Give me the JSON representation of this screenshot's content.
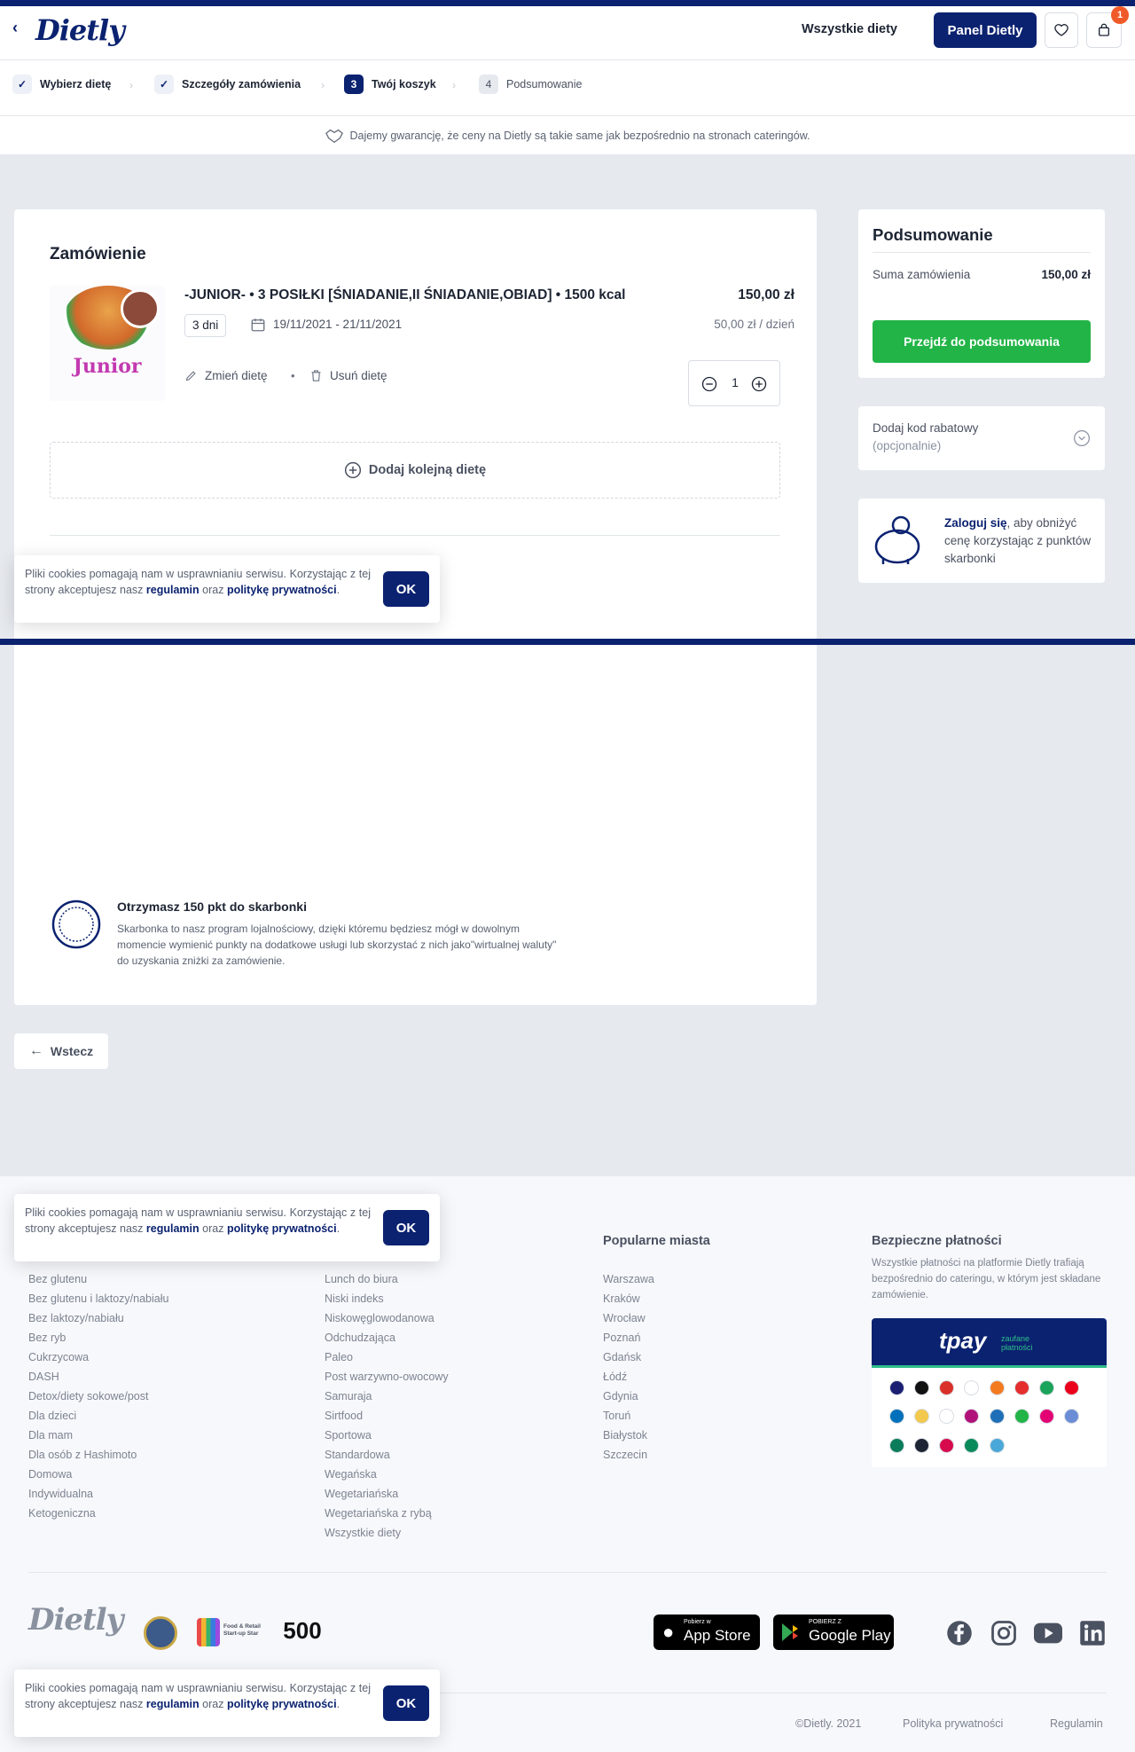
{
  "header": {
    "logo": "Dietly",
    "all_diets": "Wszystkie diety",
    "panel_button": "Panel Dietly",
    "cart_count": "1"
  },
  "steps": [
    {
      "label": "Wybierz dietę",
      "num": ""
    },
    {
      "label": "Szczegóły zamówienia",
      "num": ""
    },
    {
      "label": "Twój koszyk",
      "num": "3"
    },
    {
      "label": "Podsumowanie",
      "num": "4"
    }
  ],
  "guarantee": "Dajemy gwarancję, że ceny na Dietly są takie same jak bezpośrednio na stronach cateringów.",
  "order": {
    "title": "Zamówienie",
    "image_text": "Junior",
    "name": "-JUNIOR- • 3 POSIŁKI [ŚNIADANIE,II ŚNIADANIE,OBIAD] • 1500 kcal",
    "price": "150,00 zł",
    "days": "3 dni",
    "dates": "19/11/2021 - 21/11/2021",
    "per_day": "50,00 zł / dzień",
    "change": "Zmień dietę",
    "remove": "Usuń dietę",
    "quantity": "1",
    "add_another": "Dodaj kolejną dietę",
    "points_title": "Otrzymasz 150 pkt do skarbonki",
    "points_desc": "Skarbonka to nasz program lojalnościowy, dzięki któremu będziesz mógł w dowolnym momencie wymienić punkty na dodatkowe usługi lub skorzystać z nich jako\"wirtualnej waluty\" do uzyskania zniżki za zamówienie."
  },
  "back_button": "Wstecz",
  "summary": {
    "title": "Podsumowanie",
    "sum_label": "Suma zamówienia",
    "sum_value": "150,00 zł",
    "go_button": "Przejdź do podsumowania",
    "discount_label": "Dodaj kod rabatowy",
    "discount_optional": "(opcjonalnie)",
    "login_link": "Zaloguj się",
    "login_rest": ", aby obniżyć cenę korzystając z punktów skarbonki"
  },
  "cookie": {
    "text": "Pliki cookies pomagają nam w usprawnianiu serwisu. Korzystając z tej strony akceptujesz nasz",
    "regulamin": "regulamin",
    "oraz": "oraz",
    "privacy": "politykę prywatności",
    "ok": "OK"
  },
  "footer": {
    "col1": [
      "Bez glutenu",
      "Bez glutenu i laktozy/nabiału",
      "Bez laktozy/nabiału",
      "Bez ryb",
      "Cukrzycowa",
      "DASH",
      "Detox/diety sokowe/post",
      "Dla dzieci",
      "Dla mam",
      "Dla osób z Hashimoto",
      "Domowa",
      "Indywidualna",
      "Ketogeniczna"
    ],
    "col2": [
      "Lunch do biura",
      "Niski indeks",
      "Niskowęglowodanowa",
      "Odchudzająca",
      "Paleo",
      "Post warzywno-owocowy",
      "Samuraja",
      "Sirtfood",
      "Sportowa",
      "Standardowa",
      "Wegańska",
      "Wegetariańska",
      "Wegetariańska z rybą",
      "Wszystkie diety"
    ],
    "cities_title": "Popularne miasta",
    "cities": [
      "Warszawa",
      "Kraków",
      "Wrocław",
      "Poznań",
      "Gdańsk",
      "Łódź",
      "Gdynia",
      "Toruń",
      "Białystok",
      "Szczecin"
    ],
    "payments_title": "Bezpieczne płatności",
    "payments_desc": "Wszystkie płatności na platformie Dietly trafiają bezpośrednio do cateringu, w którym jest składane zamówienie.",
    "tpay": "tpay",
    "tpay_sub": "zaufane płatności",
    "badge_foodretail": "Food & Retail Start-up Star",
    "badge_foodtech": "500",
    "appstore_small": "Pobierz w",
    "appstore": "App Store",
    "gplay_small": "POBIERZ Z",
    "gplay": "Google Play",
    "copyright": "©Dietly. 2021",
    "privacy": "Polityka prywatności",
    "terms": "Regulamin"
  },
  "colors": {
    "navy": "#0b2270",
    "green": "#22b447",
    "badge": "#f05a28"
  }
}
